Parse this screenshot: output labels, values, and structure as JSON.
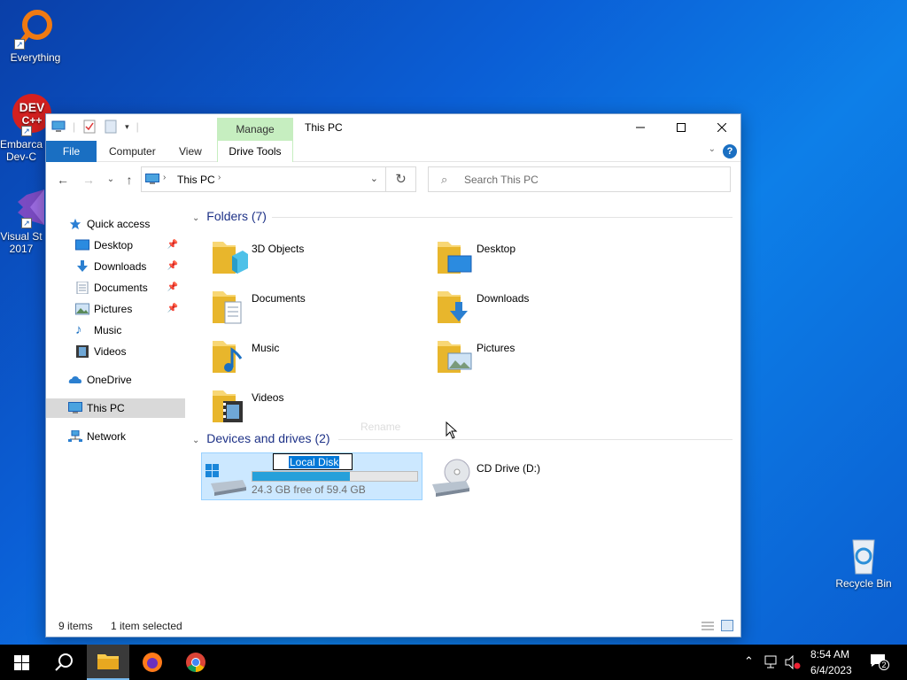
{
  "desktop": {
    "icons": [
      {
        "label": "Everything"
      },
      {
        "label": "Embarca Dev-C"
      },
      {
        "label": "Visual St 2017"
      },
      {
        "label": "Recycle Bin"
      }
    ]
  },
  "window": {
    "title": "This PC",
    "manage_tab": "Manage",
    "tabs": {
      "file": "File",
      "computer": "Computer",
      "view": "View",
      "drive_tools": "Drive Tools"
    },
    "help": "?"
  },
  "nav": {
    "address_crumb": "This PC",
    "search_placeholder": "Search This PC"
  },
  "sidebar": {
    "quick_access": "Quick access",
    "items": [
      {
        "label": "Desktop",
        "pinned": true
      },
      {
        "label": "Downloads",
        "pinned": true
      },
      {
        "label": "Documents",
        "pinned": true
      },
      {
        "label": "Pictures",
        "pinned": true
      },
      {
        "label": "Music",
        "pinned": false
      },
      {
        "label": "Videos",
        "pinned": false
      }
    ],
    "onedrive": "OneDrive",
    "this_pc": "This PC",
    "network": "Network"
  },
  "content": {
    "folders_heading": "Folders (7)",
    "folders": [
      {
        "name": "3D Objects",
        "icon": "3d-objects-icon"
      },
      {
        "name": "Desktop",
        "icon": "desktop-folder-icon"
      },
      {
        "name": "Documents",
        "icon": "documents-folder-icon"
      },
      {
        "name": "Downloads",
        "icon": "downloads-folder-icon"
      },
      {
        "name": "Music",
        "icon": "music-folder-icon"
      },
      {
        "name": "Pictures",
        "icon": "pictures-folder-icon"
      },
      {
        "name": "Videos",
        "icon": "videos-folder-icon"
      }
    ],
    "ghost_label": "Rename",
    "devices_heading": "Devices and drives (2)",
    "drives": [
      {
        "name": "Local Disk",
        "free_text": "24.3 GB free of 59.4 GB",
        "used_fraction": 0.59,
        "selected": true,
        "renaming": true
      },
      {
        "name": "CD Drive (D:)",
        "selected": false
      }
    ]
  },
  "status": {
    "items": "9 items",
    "selected": "1 item selected"
  },
  "taskbar": {
    "time": "8:54 AM",
    "date": "6/4/2023",
    "notifications": "2"
  },
  "colors": {
    "accent": "#1a6fc2",
    "selection": "#cce8ff",
    "manage_green": "#c6eec0",
    "heading_blue": "#1e3287"
  }
}
